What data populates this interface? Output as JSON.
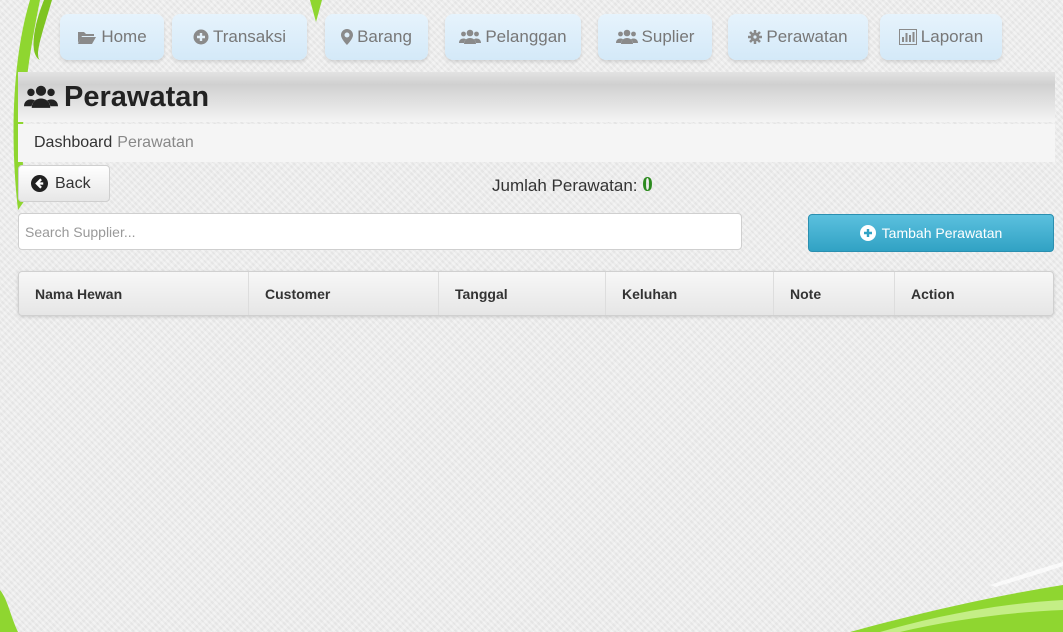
{
  "nav": {
    "tabs": [
      {
        "label": "Home",
        "icon": "folder-open-icon"
      },
      {
        "label": "Transaksi",
        "icon": "plus-circle-icon"
      },
      {
        "label": "Barang",
        "icon": "map-marker-icon"
      },
      {
        "label": "Pelanggan",
        "icon": "users-icon"
      },
      {
        "label": "Suplier",
        "icon": "users-icon"
      },
      {
        "label": "Perawatan",
        "icon": "cog-icon"
      },
      {
        "label": "Laporan",
        "icon": "bar-chart-icon"
      }
    ]
  },
  "header": {
    "title": "Perawatan",
    "icon": "users-icon"
  },
  "breadcrumb": {
    "active": "Dashboard",
    "current": "Perawatan"
  },
  "back_button": {
    "label": "Back",
    "icon": "circle-arrow-left-icon"
  },
  "count": {
    "label": "Jumlah Perawatan:",
    "value": "0"
  },
  "search": {
    "placeholder": "Search Supplier..."
  },
  "add_button": {
    "label": "Tambah Perawatan",
    "icon": "plus-circle-icon"
  },
  "table": {
    "columns": [
      "Nama Hewan",
      "Customer",
      "Tanggal",
      "Keluhan",
      "Note",
      "Action"
    ],
    "rows": []
  },
  "colors": {
    "accent": "#5bc0de",
    "count": "#2c8a1e",
    "swoosh": "#7ed321",
    "tab": "#d8ecfa"
  }
}
